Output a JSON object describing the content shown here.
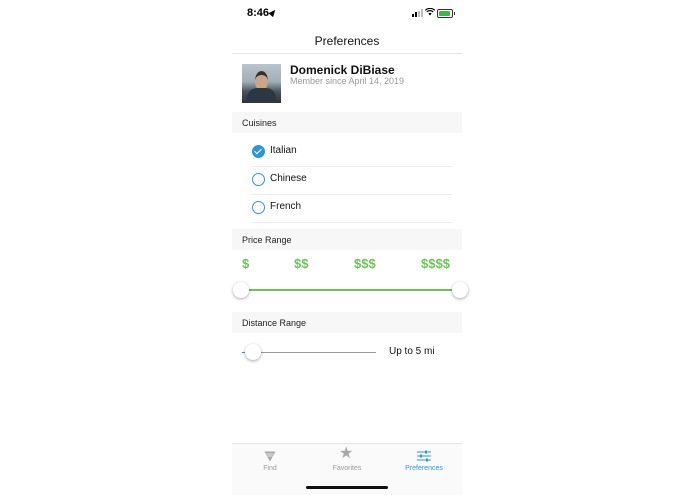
{
  "status_bar": {
    "time": "8:46"
  },
  "nav": {
    "title": "Preferences"
  },
  "profile": {
    "name": "Domenick DiBiase",
    "member_since": "Member since April 14, 2019"
  },
  "cuisines": {
    "header": "Cuisines",
    "options": [
      {
        "label": "Italian",
        "checked": true
      },
      {
        "label": "Chinese",
        "checked": false
      },
      {
        "label": "French",
        "checked": false
      }
    ]
  },
  "price_range": {
    "header": "Price Range",
    "labels": [
      "$",
      "$$",
      "$$$",
      "$$$$"
    ],
    "selected_min": "$",
    "selected_max": "$$$$"
  },
  "distance_range": {
    "header": "Distance Range",
    "value_label": "Up to 5 mi",
    "slider_value_fraction": 0.0
  },
  "tabbar": {
    "tabs": [
      {
        "label": "Find",
        "icon": "find-icon",
        "active": false
      },
      {
        "label": "Favorites",
        "icon": "star-icon",
        "active": false
      },
      {
        "label": "Preferences",
        "icon": "sliders-icon",
        "active": true
      }
    ]
  },
  "colors": {
    "accent": "#2f95d6",
    "price_green": "#6cc35a"
  }
}
